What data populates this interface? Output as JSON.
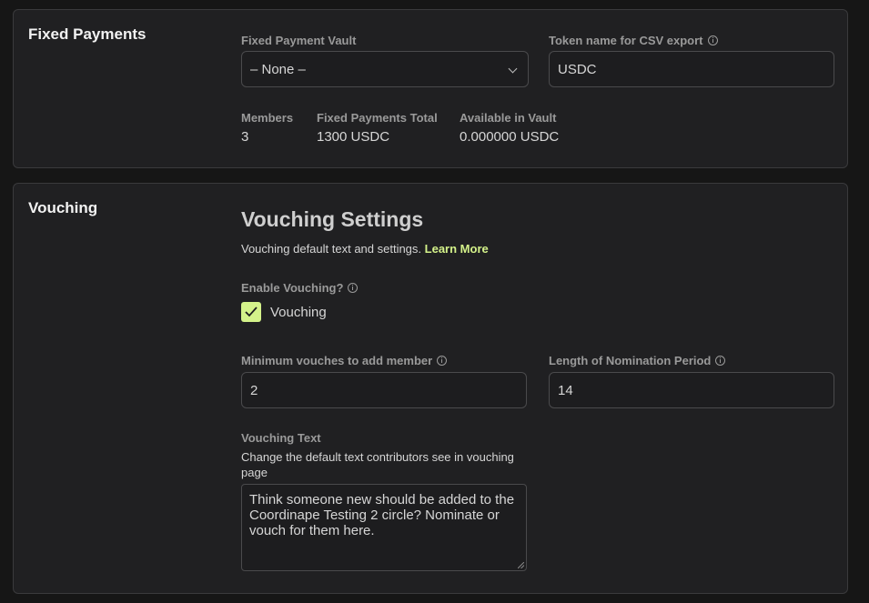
{
  "fixed_payments": {
    "title": "Fixed Payments",
    "vault_label": "Fixed Payment Vault",
    "vault_value": "– None –",
    "token_label": "Token name for CSV export",
    "token_value": "USDC",
    "stats": [
      {
        "label": "Members",
        "value": "3"
      },
      {
        "label": "Fixed Payments Total",
        "value": "1300 USDC"
      },
      {
        "label": "Available in Vault",
        "value": "0.000000 USDC"
      }
    ]
  },
  "vouching": {
    "title": "Vouching",
    "heading": "Vouching Settings",
    "description": "Vouching default text and settings.",
    "learn_more": "Learn More",
    "enable_label": "Enable Vouching?",
    "checkbox_label": "Vouching",
    "checkbox_checked": true,
    "min_vouches_label": "Minimum vouches to add member",
    "min_vouches_value": "2",
    "nomination_label": "Length of Nomination Period",
    "nomination_value": "14",
    "text_label": "Vouching Text",
    "text_help": "Change the default text contributors see in vouching page",
    "text_value": "Think someone new should be added to the Coordinape Testing 2 circle? Nominate or vouch for them here."
  },
  "colors": {
    "accent": "#d4f28a",
    "panel_bg": "#202022",
    "page_bg": "#161616"
  }
}
